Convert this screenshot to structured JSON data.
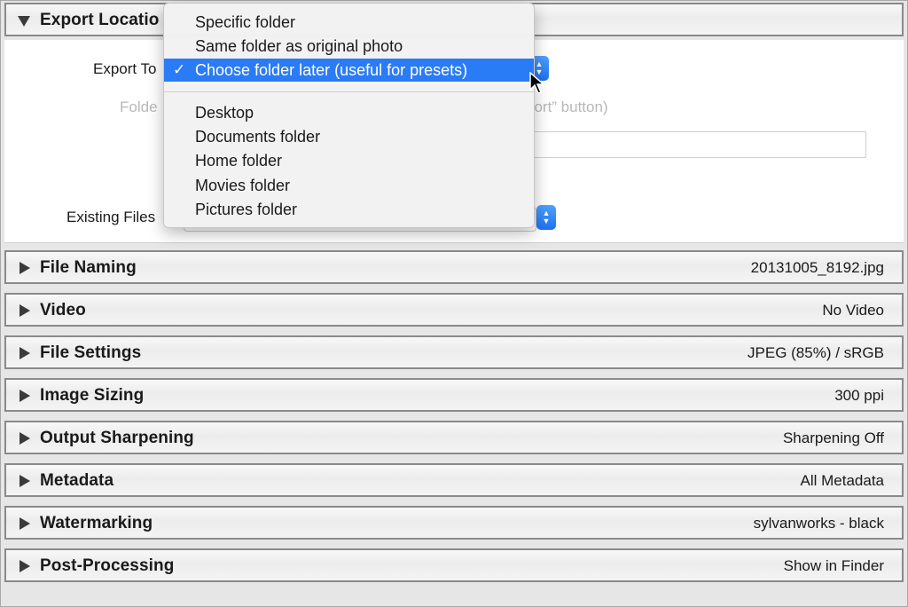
{
  "export_location": {
    "title": "Export Locatio",
    "export_to_label": "Export To",
    "folder_label": "Folde",
    "folder_note": "port” button)",
    "existing_files_label": "Existing Files"
  },
  "dropdown": {
    "items_top": [
      {
        "label": "Specific folder"
      },
      {
        "label": "Same folder as original photo"
      },
      {
        "label": "Choose folder later (useful for presets)",
        "selected": true
      }
    ],
    "items_bottom": [
      {
        "label": "Desktop"
      },
      {
        "label": "Documents folder"
      },
      {
        "label": "Home folder"
      },
      {
        "label": "Movies folder"
      },
      {
        "label": "Pictures folder"
      }
    ],
    "check_glyph": "✓"
  },
  "sections": [
    {
      "title": "File Naming",
      "summary": "20131005_8192.jpg"
    },
    {
      "title": "Video",
      "summary": "No Video"
    },
    {
      "title": "File Settings",
      "summary": "JPEG (85%) / sRGB"
    },
    {
      "title": "Image Sizing",
      "summary": "300 ppi"
    },
    {
      "title": "Output Sharpening",
      "summary": "Sharpening Off"
    },
    {
      "title": "Metadata",
      "summary": "All Metadata"
    },
    {
      "title": "Watermarking",
      "summary": "sylvanworks - black"
    },
    {
      "title": "Post-Processing",
      "summary": "Show in Finder"
    }
  ],
  "colors": {
    "accent": "#2a7bf6",
    "section_border": "#8a8a8a",
    "triangle": "#3a3a3a"
  },
  "icons": {
    "expanded": "triangle-down-icon",
    "collapsed": "triangle-right-icon",
    "stepper": "chevron-up-down-icon",
    "cursor": "mouse-pointer-icon"
  }
}
